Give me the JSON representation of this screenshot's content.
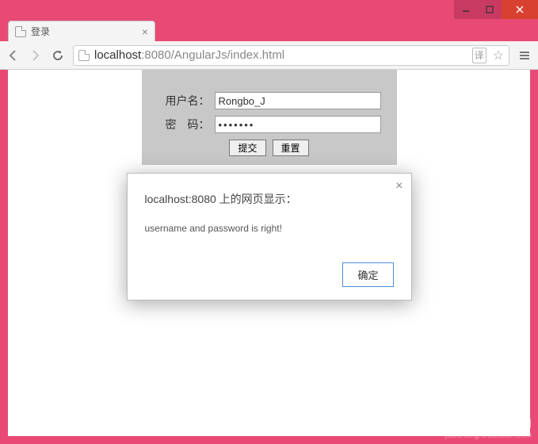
{
  "window": {
    "minimize_label": "—",
    "maximize_label": "□",
    "close_label": "✕"
  },
  "tab": {
    "title": "登录",
    "close_label": "×"
  },
  "addressbar": {
    "url_scheme_host": "localhost",
    "url_port_path": ":8080/AngularJs/index.html",
    "translate_hint": "译",
    "star_label": "☆"
  },
  "form": {
    "username_label": "用户名：",
    "username_value": "Rongbo_J",
    "password_label": "密　码：",
    "password_value": "•••••••",
    "submit_label": "提交",
    "reset_label": "重置"
  },
  "dialog": {
    "title": "localhost:8080 上的网页显示：",
    "message": "username and password is right!",
    "ok_label": "确定",
    "close_label": "×"
  },
  "watermark": {
    "line1": "查字典 | 教程网",
    "line2": "jiaocheng.chazidian.com"
  }
}
